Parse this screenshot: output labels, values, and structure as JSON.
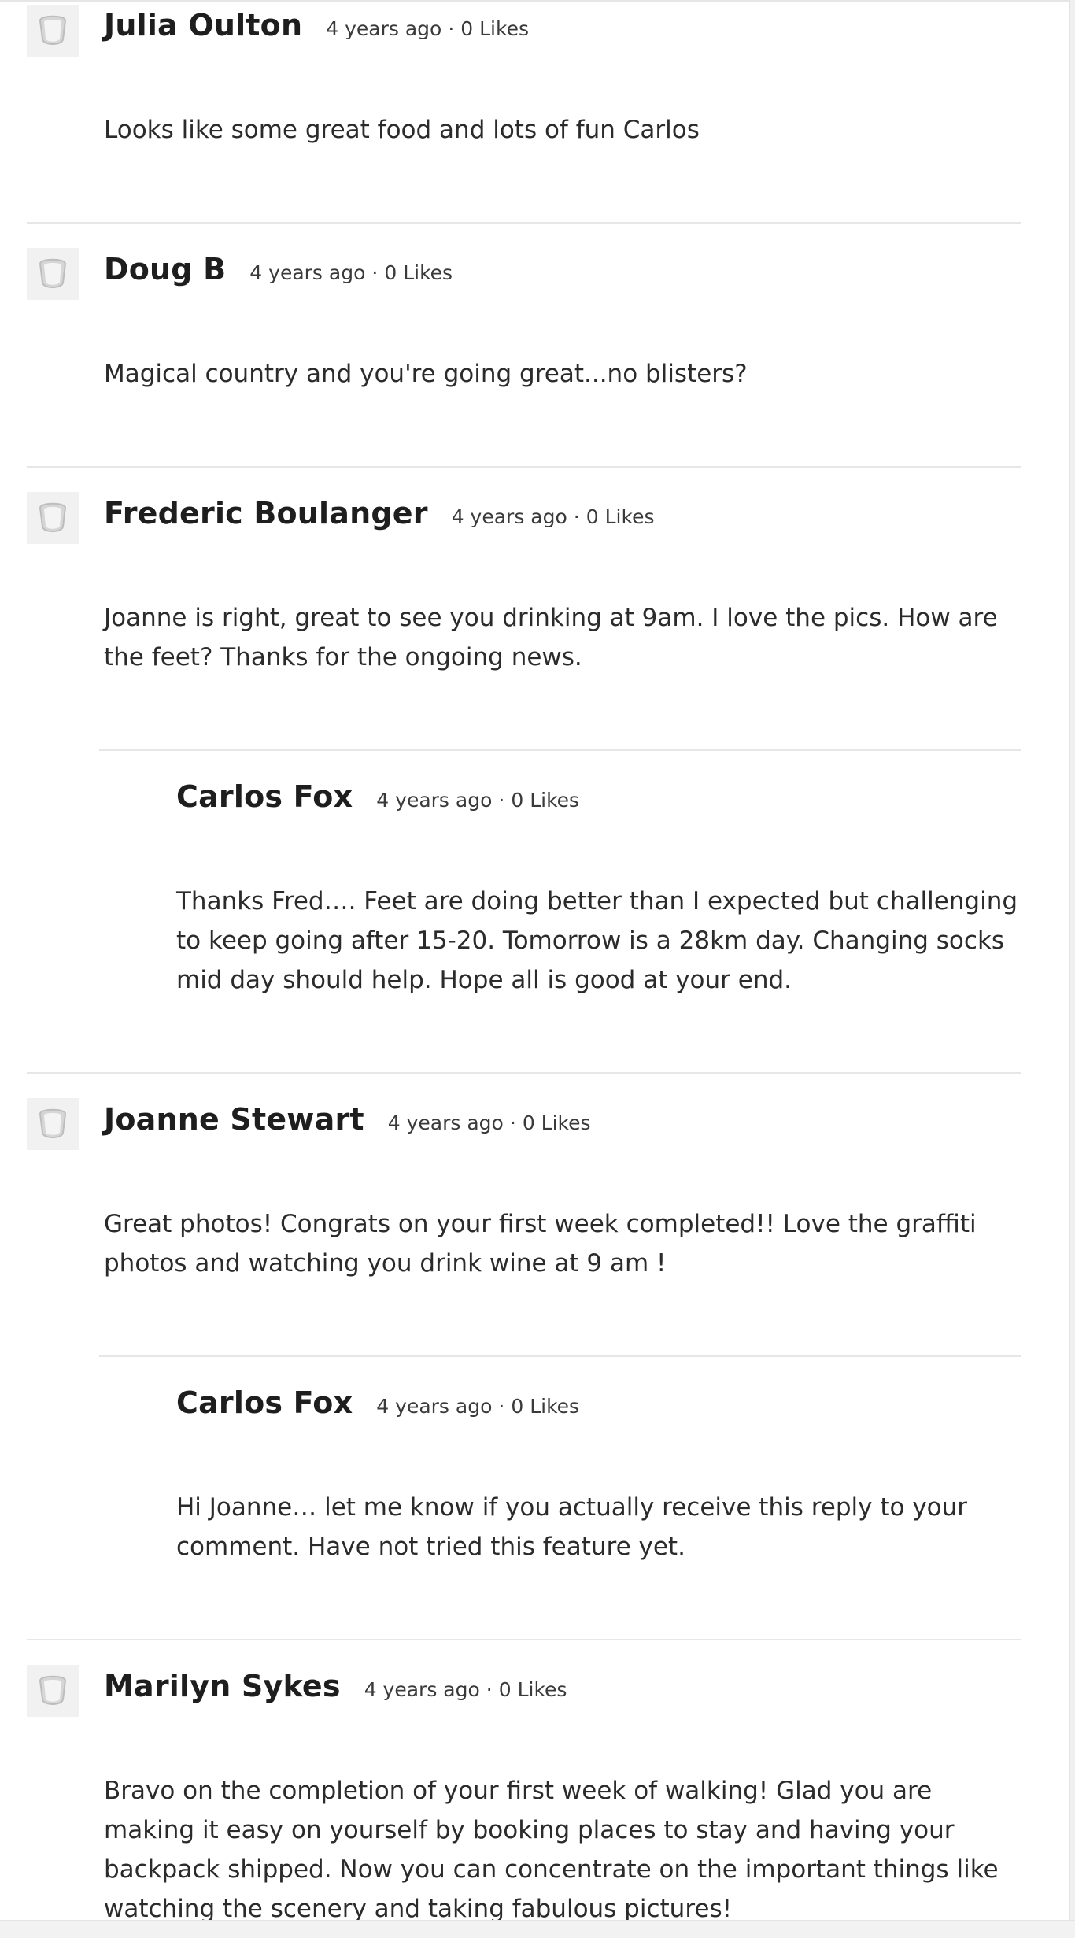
{
  "comments": [
    {
      "author": "Julia Oulton",
      "time": "4 years ago",
      "likes": "0 Likes",
      "text": "Looks like some great food and lots of fun Carlos",
      "reply": false
    },
    {
      "author": "Doug B",
      "time": "4 years ago",
      "likes": "0 Likes",
      "text": "Magical country and you're going great...no blisters?",
      "reply": false
    },
    {
      "author": "Frederic Boulanger",
      "time": "4 years ago",
      "likes": "0 Likes",
      "text": "Joanne is right, great to see you drinking at 9am. I love the pics. How are the feet? Thanks for the ongoing news.",
      "reply": false
    },
    {
      "author": "Carlos Fox",
      "time": "4 years ago",
      "likes": "0 Likes",
      "text": "Thanks Fred…. Feet are doing better than I expected but challenging to keep going after 15-20. Tomorrow is a 28km day. Changing socks mid day should help. Hope all is good at your end.",
      "reply": true
    },
    {
      "author": "Joanne Stewart",
      "time": "4 years ago",
      "likes": "0 Likes",
      "text": "Great photos! Congrats on your first week completed!! Love the graffiti photos and watching you drink wine at 9 am !",
      "reply": false
    },
    {
      "author": "Carlos Fox",
      "time": "4 years ago",
      "likes": "0 Likes",
      "text": "Hi Joanne… let me know if you actually receive this reply to your comment. Have not tried this feature yet.",
      "reply": true
    },
    {
      "author": "Marilyn Sykes",
      "time": "4 years ago",
      "likes": "0 Likes",
      "text": "Bravo on the completion of your first week of walking! Glad you are making it easy on yourself by booking places to stay and having your backpack shipped. Now you can concentrate on the important things like watching the scenery and taking fabulous pictures!",
      "reply": false
    }
  ]
}
